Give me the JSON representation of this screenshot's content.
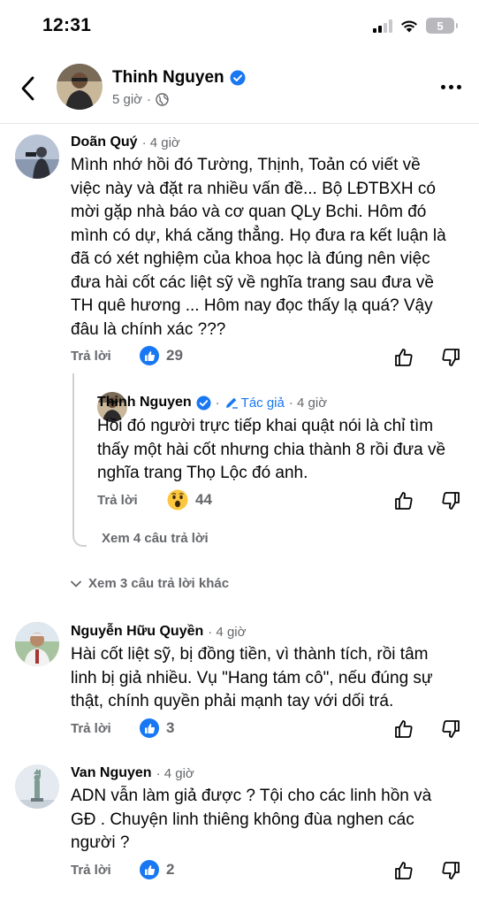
{
  "status_bar": {
    "time": "12:31",
    "battery": "5"
  },
  "header": {
    "name": "Thinh Nguyen",
    "time": "5 giờ"
  },
  "comments": [
    {
      "author": "Doãn Quý",
      "time": "· 4 giờ",
      "lines": [
        "Mình nhớ hồi đó Tường, Thịnh, Toản có viết về",
        "việc này và đặt ra nhiều vấn đề... Bộ LĐTBXH có",
        "mời gặp nhà báo và cơ quan QLy Bchi. Hôm đó",
        "mình có dự, khá căng thẳng. Họ đưa ra kết luận là",
        "đã có xét nghiệm của khoa học là đúng nên việc",
        "đưa hài cốt các liệt sỹ về nghĩa trang sau đưa về",
        "TH quê hương ... Hôm nay đọc thấy lạ quá? Vậy",
        "đâu là chính xác ???"
      ],
      "reply_label": "Trả lời",
      "reaction_count": "29"
    },
    {
      "author": "Nguyễn Hữu Quyền",
      "time": "· 4 giờ",
      "lines": [
        "Hài cốt liệt sỹ, bị đồng tiền, vì thành tích, rồi tâm",
        "linh bị giả nhiều. Vụ \"Hang tám cô\", nếu đúng sự",
        "thật, chính quyền phải mạnh tay với dối trá."
      ],
      "reply_label": "Trả lời",
      "reaction_count": "3"
    },
    {
      "author": "Van Nguyen",
      "time": "· 4 giờ",
      "lines": [
        "ADN vẫn làm giả được ? Tội cho các linh hồn và",
        "GĐ . Chuyện linh thiêng không đùa nghen các",
        "người ?"
      ],
      "reply_label": "Trả lời",
      "reaction_count": "2"
    }
  ],
  "reply": {
    "author": "Thinh Nguyen",
    "author_tag": "Tác giả",
    "time": "· 4 giờ",
    "lines": [
      "Hồi đó người trực tiếp khai quật nói là chỉ tìm",
      "thấy một hài cốt nhưng chia thành 8 rồi đưa về",
      "nghĩa trang Thọ Lộc đó anh."
    ],
    "reply_label": "Trả lời",
    "reaction_count": "44",
    "see_replies": "Xem 4 câu trả lời"
  },
  "see_more_replies": "Xem 3 câu trả lời khác",
  "colors": {
    "accent": "#1877f2",
    "secondary_text": "#65676b",
    "divider": "#e4e6eb"
  }
}
